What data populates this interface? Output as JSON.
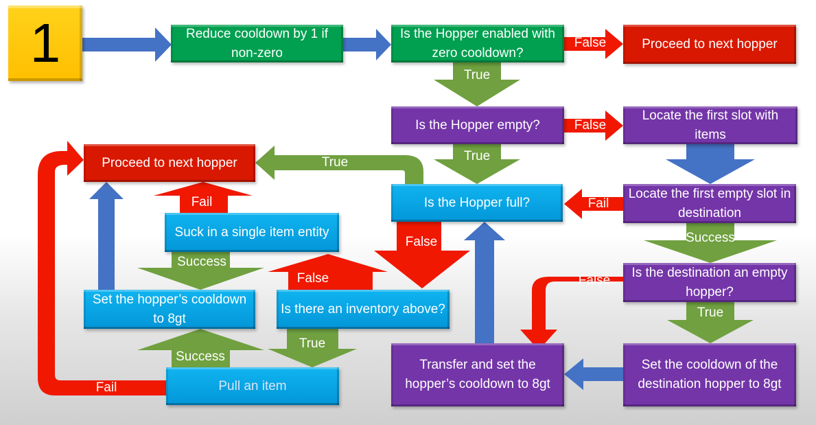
{
  "start": {
    "number": "1"
  },
  "boxes": {
    "reduce_cooldown": "Reduce cooldown by 1 if non-zero",
    "hopper_enabled": "Is the Hopper enabled with zero cooldown?",
    "next_hopper_top": "Proceed to next hopper",
    "hopper_empty": "Is the Hopper empty?",
    "locate_first_slot": "Locate the first slot with items",
    "locate_empty_slot": "Locate the first empty slot in destination",
    "hopper_full": "Is the Hopper full?",
    "next_hopper_left": "Proceed to next hopper",
    "dest_empty_hopper": "Is the destination an empty hopper?",
    "set_dest_cooldown": "Set the cooldown of the destination hopper to 8gt",
    "transfer": "Transfer and set the hopper’s cooldown to 8gt",
    "suck_item": "Suck in a single item entity",
    "set_cooldown": "Set the hopper’s cooldown to 8gt",
    "inventory_above": "Is there an inventory above?",
    "pull_item": "Pull an item"
  },
  "labels": {
    "false1": "False",
    "true1": "True",
    "false2": "False",
    "true2": "True",
    "fail1": "Fail",
    "true_full": "True",
    "false_full": "False",
    "success1": "Success",
    "false_dest": "False",
    "true_dest": "True",
    "fail_suck": "Fail",
    "success_suck": "Success",
    "false_inv": "False",
    "true_inv": "True",
    "success_pull": "Success",
    "fail_pull": "Fail"
  },
  "colors": {
    "start": "#FFC000",
    "green": "#00A050",
    "red": "#D81800",
    "purple": "#7335A8",
    "cyan": "#0AA8EC",
    "blue_arrow": "#4472C4",
    "green_arrow": "#70A040"
  }
}
